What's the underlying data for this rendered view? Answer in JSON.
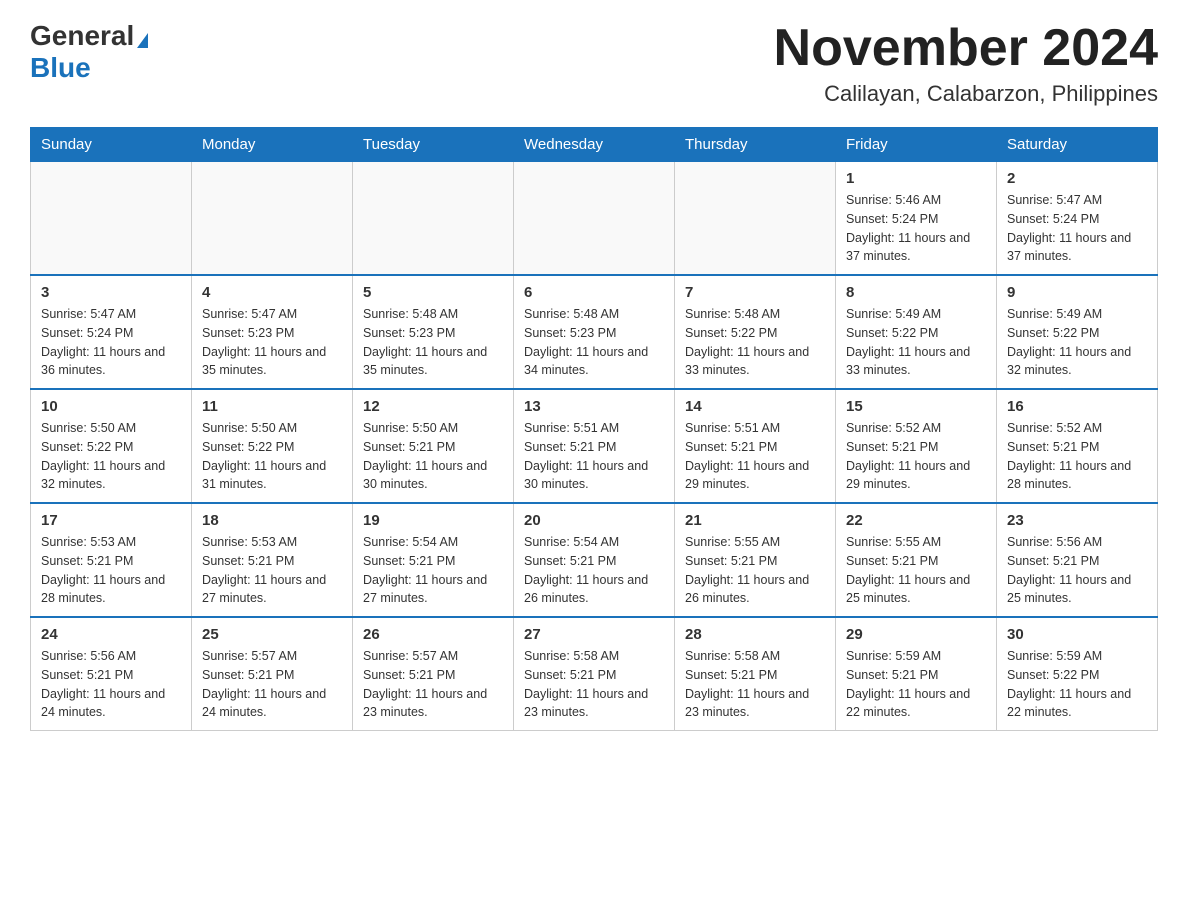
{
  "header": {
    "logo": {
      "general": "General",
      "blue": "Blue"
    },
    "title": "November 2024",
    "location": "Calilayan, Calabarzon, Philippines"
  },
  "calendar": {
    "days_of_week": [
      "Sunday",
      "Monday",
      "Tuesday",
      "Wednesday",
      "Thursday",
      "Friday",
      "Saturday"
    ],
    "weeks": [
      [
        {
          "day": "",
          "info": ""
        },
        {
          "day": "",
          "info": ""
        },
        {
          "day": "",
          "info": ""
        },
        {
          "day": "",
          "info": ""
        },
        {
          "day": "",
          "info": ""
        },
        {
          "day": "1",
          "info": "Sunrise: 5:46 AM\nSunset: 5:24 PM\nDaylight: 11 hours and 37 minutes."
        },
        {
          "day": "2",
          "info": "Sunrise: 5:47 AM\nSunset: 5:24 PM\nDaylight: 11 hours and 37 minutes."
        }
      ],
      [
        {
          "day": "3",
          "info": "Sunrise: 5:47 AM\nSunset: 5:24 PM\nDaylight: 11 hours and 36 minutes."
        },
        {
          "day": "4",
          "info": "Sunrise: 5:47 AM\nSunset: 5:23 PM\nDaylight: 11 hours and 35 minutes."
        },
        {
          "day": "5",
          "info": "Sunrise: 5:48 AM\nSunset: 5:23 PM\nDaylight: 11 hours and 35 minutes."
        },
        {
          "day": "6",
          "info": "Sunrise: 5:48 AM\nSunset: 5:23 PM\nDaylight: 11 hours and 34 minutes."
        },
        {
          "day": "7",
          "info": "Sunrise: 5:48 AM\nSunset: 5:22 PM\nDaylight: 11 hours and 33 minutes."
        },
        {
          "day": "8",
          "info": "Sunrise: 5:49 AM\nSunset: 5:22 PM\nDaylight: 11 hours and 33 minutes."
        },
        {
          "day": "9",
          "info": "Sunrise: 5:49 AM\nSunset: 5:22 PM\nDaylight: 11 hours and 32 minutes."
        }
      ],
      [
        {
          "day": "10",
          "info": "Sunrise: 5:50 AM\nSunset: 5:22 PM\nDaylight: 11 hours and 32 minutes."
        },
        {
          "day": "11",
          "info": "Sunrise: 5:50 AM\nSunset: 5:22 PM\nDaylight: 11 hours and 31 minutes."
        },
        {
          "day": "12",
          "info": "Sunrise: 5:50 AM\nSunset: 5:21 PM\nDaylight: 11 hours and 30 minutes."
        },
        {
          "day": "13",
          "info": "Sunrise: 5:51 AM\nSunset: 5:21 PM\nDaylight: 11 hours and 30 minutes."
        },
        {
          "day": "14",
          "info": "Sunrise: 5:51 AM\nSunset: 5:21 PM\nDaylight: 11 hours and 29 minutes."
        },
        {
          "day": "15",
          "info": "Sunrise: 5:52 AM\nSunset: 5:21 PM\nDaylight: 11 hours and 29 minutes."
        },
        {
          "day": "16",
          "info": "Sunrise: 5:52 AM\nSunset: 5:21 PM\nDaylight: 11 hours and 28 minutes."
        }
      ],
      [
        {
          "day": "17",
          "info": "Sunrise: 5:53 AM\nSunset: 5:21 PM\nDaylight: 11 hours and 28 minutes."
        },
        {
          "day": "18",
          "info": "Sunrise: 5:53 AM\nSunset: 5:21 PM\nDaylight: 11 hours and 27 minutes."
        },
        {
          "day": "19",
          "info": "Sunrise: 5:54 AM\nSunset: 5:21 PM\nDaylight: 11 hours and 27 minutes."
        },
        {
          "day": "20",
          "info": "Sunrise: 5:54 AM\nSunset: 5:21 PM\nDaylight: 11 hours and 26 minutes."
        },
        {
          "day": "21",
          "info": "Sunrise: 5:55 AM\nSunset: 5:21 PM\nDaylight: 11 hours and 26 minutes."
        },
        {
          "day": "22",
          "info": "Sunrise: 5:55 AM\nSunset: 5:21 PM\nDaylight: 11 hours and 25 minutes."
        },
        {
          "day": "23",
          "info": "Sunrise: 5:56 AM\nSunset: 5:21 PM\nDaylight: 11 hours and 25 minutes."
        }
      ],
      [
        {
          "day": "24",
          "info": "Sunrise: 5:56 AM\nSunset: 5:21 PM\nDaylight: 11 hours and 24 minutes."
        },
        {
          "day": "25",
          "info": "Sunrise: 5:57 AM\nSunset: 5:21 PM\nDaylight: 11 hours and 24 minutes."
        },
        {
          "day": "26",
          "info": "Sunrise: 5:57 AM\nSunset: 5:21 PM\nDaylight: 11 hours and 23 minutes."
        },
        {
          "day": "27",
          "info": "Sunrise: 5:58 AM\nSunset: 5:21 PM\nDaylight: 11 hours and 23 minutes."
        },
        {
          "day": "28",
          "info": "Sunrise: 5:58 AM\nSunset: 5:21 PM\nDaylight: 11 hours and 23 minutes."
        },
        {
          "day": "29",
          "info": "Sunrise: 5:59 AM\nSunset: 5:21 PM\nDaylight: 11 hours and 22 minutes."
        },
        {
          "day": "30",
          "info": "Sunrise: 5:59 AM\nSunset: 5:22 PM\nDaylight: 11 hours and 22 minutes."
        }
      ]
    ]
  }
}
